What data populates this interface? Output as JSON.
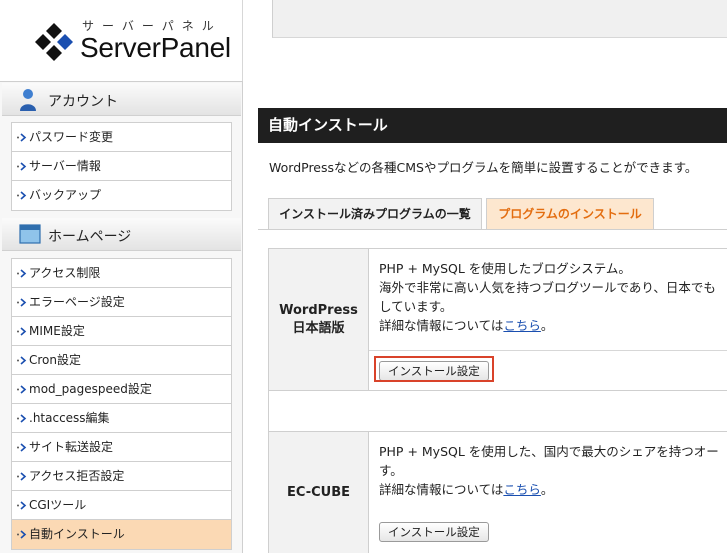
{
  "app": {
    "logo_kana": "サーバーパネル",
    "logo_text": "ServerPanel"
  },
  "sidebar": {
    "account": {
      "title": "アカウント",
      "items": [
        "パスワード変更",
        "サーバー情報",
        "バックアップ"
      ]
    },
    "homepage": {
      "title": "ホームページ",
      "items": [
        "アクセス制限",
        "エラーページ設定",
        "MIME設定",
        "Cron設定",
        "mod_pagespeed設定",
        ".htaccess編集",
        "サイト転送設定",
        "アクセス拒否設定",
        "CGIツール",
        "自動インストール"
      ],
      "active_item": "自動インストール"
    }
  },
  "main": {
    "title": "自動インストール",
    "description": "WordPressなどの各種CMSやプログラムを簡単に設置することができます。",
    "tabs": [
      {
        "label": "インストール済みプログラムの一覧",
        "active": false
      },
      {
        "label": "プログラムのインストール",
        "active": true
      }
    ],
    "programs": [
      {
        "name_line1": "WordPress",
        "name_line2": "日本語版",
        "desc_line1": "PHP + MySQL を使用したブログシステム。",
        "desc_line2": "海外で非常に高い人気を持つブログツールであり、日本でも",
        "desc_line3": "しています。",
        "detail_prefix": "詳細な情報については",
        "detail_link": "こちら",
        "detail_suffix": "。",
        "button_label": "インストール設定"
      },
      {
        "name_line1": "EC-CUBE",
        "desc_line1": "PHP + MySQL を使用した、国内で最大のシェアを持つオー",
        "desc_line2": "す。",
        "detail_prefix": "詳細な情報については",
        "detail_link": "こちら",
        "detail_suffix": "。",
        "button_label": "インストール設定"
      }
    ]
  },
  "colors": {
    "title_bar": "#1f1f1f",
    "active_tab_text": "#e36d10",
    "active_tab_bg": "#fde7cf",
    "active_menu_bg": "#fbd9b4",
    "link": "#1a4fb0",
    "highlight": "#d9432a"
  },
  "icons": {
    "logo": "diamond-logo-icon",
    "account": "user-icon",
    "homepage": "window-icon",
    "menu_arrow": "dotted-arrow-icon"
  }
}
